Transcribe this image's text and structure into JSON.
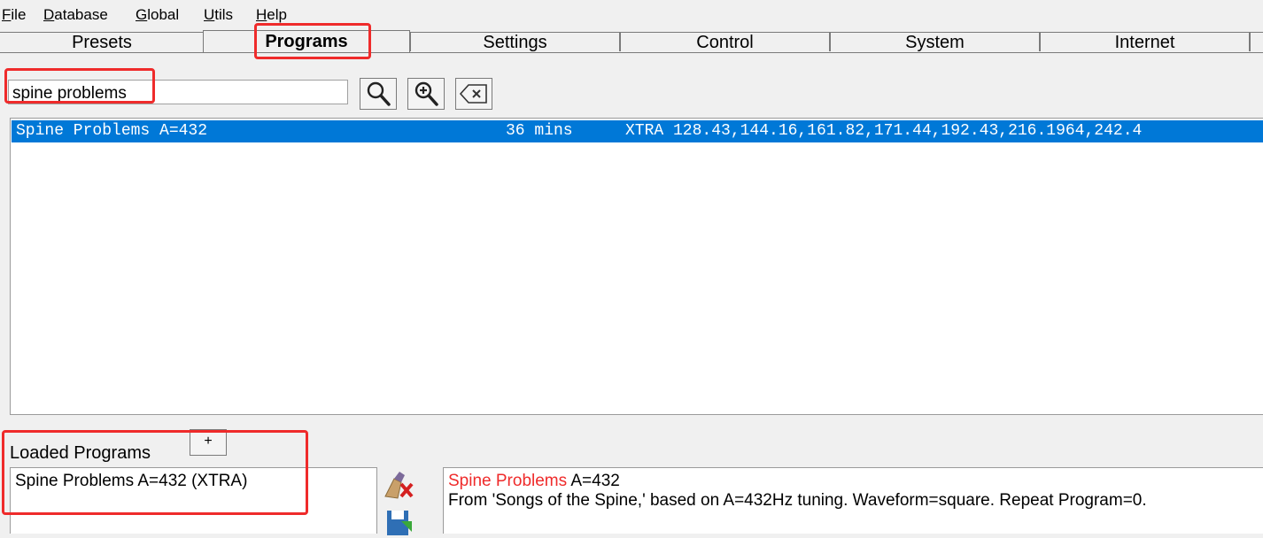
{
  "menu": {
    "items": [
      {
        "key": "F",
        "rest": "ile"
      },
      {
        "key": "D",
        "rest": "atabase"
      },
      {
        "key": "G",
        "rest": "lobal"
      },
      {
        "key": "U",
        "rest": "tils"
      },
      {
        "key": "H",
        "rest": "elp"
      }
    ]
  },
  "tabs": [
    "Presets",
    "Programs",
    "Settings",
    "Control",
    "System",
    "Internet"
  ],
  "active_tab": "Programs",
  "search": {
    "value": "spine problems",
    "icons": [
      "search-icon",
      "zoom-in-icon",
      "clear-icon"
    ]
  },
  "results": [
    {
      "name": "Spine Problems A=432",
      "duration": "36 mins",
      "frequencies": "XTRA 128.43,144.16,161.82,171.44,192.43,216.1964,242.4"
    }
  ],
  "loaded": {
    "label": "Loaded Programs",
    "add_label": "+",
    "items": [
      "Spine Problems A=432 (XTRA)"
    ],
    "icons": [
      "remove-program-icon",
      "save-program-icon"
    ]
  },
  "description": {
    "name": "Spine Problems",
    "name_rest": " A=432",
    "text": "From 'Songs of the Spine,' based on A=432Hz tuning. Waveform=square. Repeat Program=0."
  },
  "colors": {
    "selection": "#0078d7",
    "highlight_box": "#ef2b2b",
    "program_name": "#ef2b2b"
  }
}
